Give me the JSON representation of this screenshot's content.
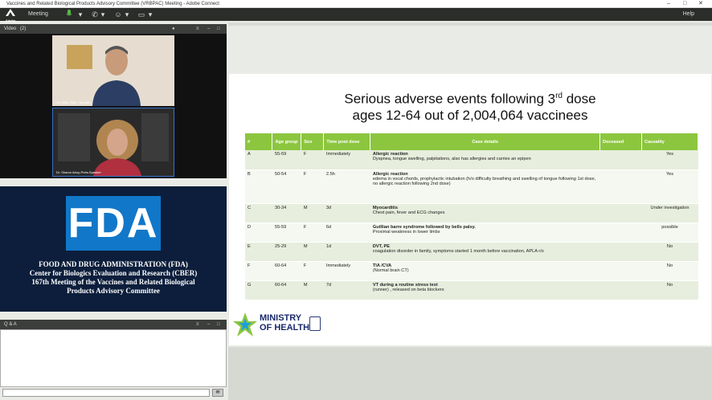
{
  "window": {
    "title": "Vaccines and Related Biological Products Advisory Committee (VRBPAC) Meeting - Adobe Connect",
    "controls": {
      "minimize": "–",
      "maximize": "□",
      "close": "✕"
    }
  },
  "menubar": {
    "logo_text": "Adobe",
    "meeting_label": "Meeting",
    "help_label": "Help",
    "icons": [
      "microphone-icon",
      "phone-icon",
      "user-status-icon",
      "screen-share-icon"
    ]
  },
  "video_pod": {
    "title": "Video",
    "count": "(2)",
    "participants": [
      {
        "name": "Ron Milo, PhD - Speaker"
      },
      {
        "name": "Dr. Sharon Alroy-Preis-Speaker"
      }
    ]
  },
  "fda_pod": {
    "logo": "FDA",
    "lines": [
      "FOOD AND DRUG ADMINISTRATION (FDA)",
      "Center for Biologics Evaluation and Research (CBER)",
      "167th Meeting of the Vaccines and Related Biological",
      "Products Advisory Committee"
    ]
  },
  "qa_pod": {
    "title": "Q & A",
    "input_placeholder": "",
    "send_icon": "send-icon"
  },
  "slide": {
    "title_line1_pre": "Serious adverse events following 3",
    "title_line1_sup": "rd",
    "title_line1_post": " dose",
    "title_line2": "ages 12-64 out of 2,004,064 vaccinees",
    "columns": [
      "#",
      "Age group",
      "Sex",
      "Time post dose",
      "Case details",
      "Deceased",
      "Causality"
    ],
    "rows": [
      {
        "id": "A",
        "age": "55-59",
        "sex": "F",
        "time": "Immediately",
        "title": "Allergic reaction",
        "detail": "Dyspnea, tongue swelling, palpitations, also has allergies and carries an epipen",
        "deceased": "",
        "causality": "Yes"
      },
      {
        "id": "B",
        "age": "50-54",
        "sex": "F",
        "time": "2.5h",
        "title": "Allergic reaction",
        "detail": "edema in vocal chords, prophylactic intubation (h/o difficulty breathing and swelling of tongue following 1st dose, no allergic reaction following 2nd dose)",
        "deceased": "",
        "causality": "Yes"
      },
      {
        "id": "C",
        "age": "30-34",
        "sex": "M",
        "time": "3d",
        "title": "Myocarditis",
        "detail": "Chest pain, fever and ECG changes",
        "deceased": "",
        "causality": "Under investigation"
      },
      {
        "id": "D",
        "age": "55-59",
        "sex": "F",
        "time": "6d",
        "title": "Guillian barre syndrome followed by bells palsy.",
        "detail": "Proximal weakness in lower limbs",
        "deceased": "",
        "causality": "possible"
      },
      {
        "id": "E",
        "age": "25-29",
        "sex": "M",
        "time": "1d",
        "title": "DVT, PE",
        "detail": "coagulation disorder in family, symptoms started 1 month before vaccination, APLA r/o",
        "deceased": "",
        "causality": "No"
      },
      {
        "id": "F",
        "age": "60-64",
        "sex": "F",
        "time": "Immediately",
        "title": "TIA /CVA",
        "detail": "(Normal brain CT)",
        "deceased": "",
        "causality": "No"
      },
      {
        "id": "G",
        "age": "60-64",
        "sex": "M",
        "time": "7d",
        "title": "VT during a routine stress test",
        "detail": "(runner) , released on beta blockers",
        "deceased": "",
        "causality": "No"
      }
    ],
    "logo_line1": "MINISTRY",
    "logo_line2": "OF HEALTH"
  },
  "colors": {
    "table_header": "#8cc63f",
    "fda_blue": "#1177c9",
    "fda_background": "#0c1e3b",
    "ministry_text": "#1a2a6c"
  }
}
